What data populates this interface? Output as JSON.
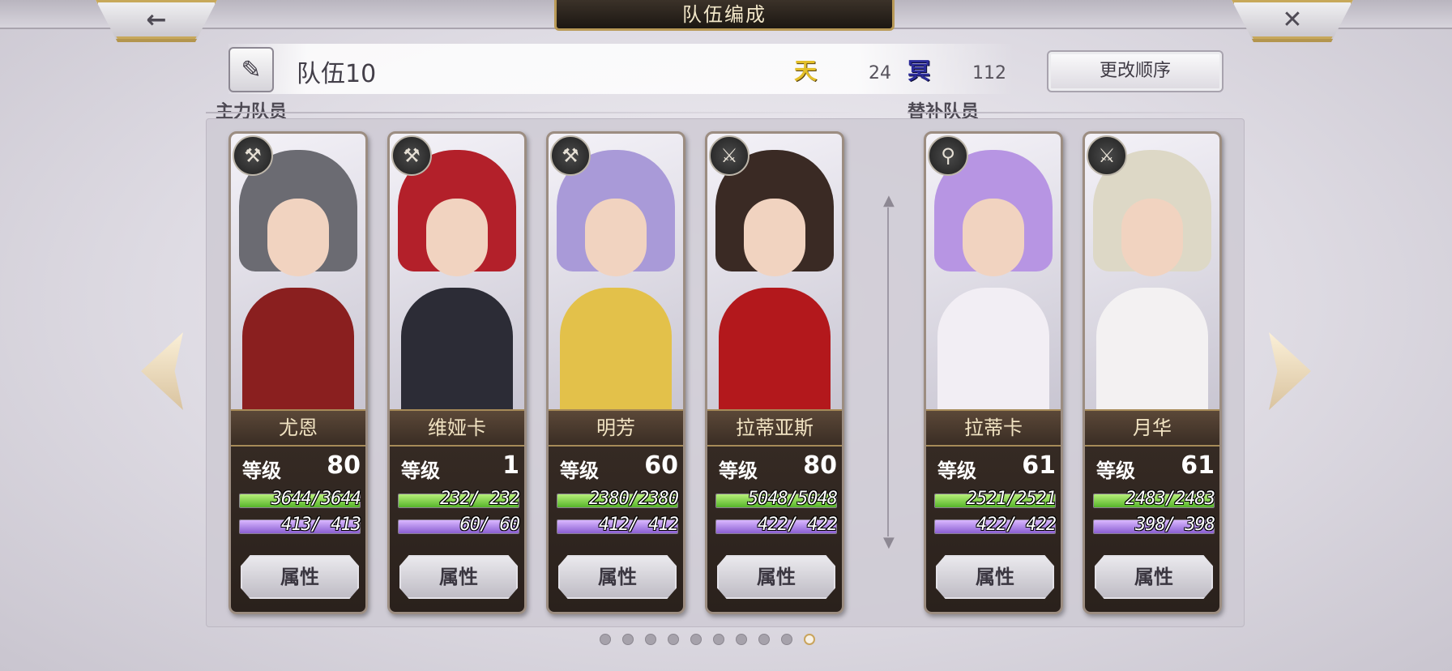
{
  "header": {
    "title": "队伍编成",
    "back_icon": "←",
    "close_icon": "✕"
  },
  "team": {
    "name": "队伍10",
    "edit_icon": "✎",
    "heaven_icon": "天",
    "heaven_count": "24",
    "dark_icon": "冥",
    "dark_count": "112",
    "reorder_label": "更改顺序"
  },
  "sections": {
    "main": "主力队员",
    "sub": "替补队员"
  },
  "level_label": "等级",
  "attr_label": "属性",
  "members": [
    {
      "name": "尤恩",
      "level": "80",
      "hp": "3644/3644",
      "mp": "413/ 413",
      "hp_pct": 1.0,
      "mp_pct": 1.0,
      "class_icon": "⚒",
      "hair": "#6b6b72",
      "body": "#8a1f1f"
    },
    {
      "name": "维娅卡",
      "level": "1",
      "hp": "232/ 232",
      "mp": "60/  60",
      "hp_pct": 1.0,
      "mp_pct": 1.0,
      "class_icon": "⚒",
      "hair": "#b3202a",
      "body": "#2c2c36"
    },
    {
      "name": "明芳",
      "level": "60",
      "hp": "2380/2380",
      "mp": "412/ 412",
      "hp_pct": 1.0,
      "mp_pct": 1.0,
      "class_icon": "⚒",
      "hair": "#a99ad8",
      "body": "#e3c14a"
    },
    {
      "name": "拉蒂亚斯",
      "level": "80",
      "hp": "5048/5048",
      "mp": "422/ 422",
      "hp_pct": 1.0,
      "mp_pct": 1.0,
      "class_icon": "⚔",
      "hair": "#3a2a24",
      "body": "#b3181c"
    }
  ],
  "subs": [
    {
      "name": "拉蒂卡",
      "level": "61",
      "hp": "2521/2521",
      "mp": "422/ 422",
      "hp_pct": 1.0,
      "mp_pct": 1.0,
      "class_icon": "⚲",
      "hair": "#b795e3",
      "body": "#f2eef4"
    },
    {
      "name": "月华",
      "level": "61",
      "hp": "2483/2483",
      "mp": "398/ 398",
      "hp_pct": 1.0,
      "mp_pct": 1.0,
      "class_icon": "⚔",
      "hair": "#ddd8c6",
      "body": "#f3f1f2"
    }
  ],
  "pager": {
    "total": 10,
    "active": 10
  }
}
